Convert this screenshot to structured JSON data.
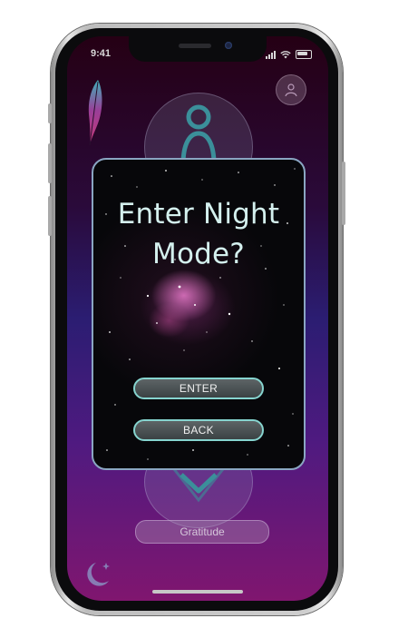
{
  "status_bar": {
    "time": "9:41",
    "icons": [
      "cellular-signal-icon",
      "wifi-icon",
      "battery-icon"
    ]
  },
  "background_screen": {
    "icons": [
      "feather-icon",
      "profile-circle-icon",
      "meditation-figure-icon",
      "heart-icon",
      "moon-star-icon"
    ],
    "gratitude_label": "Gratitude"
  },
  "modal": {
    "title_line1": "Enter Night",
    "title_line2": "Mode?",
    "enter_label": "ENTER",
    "back_label": "BACK"
  },
  "colors": {
    "accent_teal": "#86d4cf",
    "title_text": "#d4f0ee",
    "gradient_top": "#250014",
    "gradient_mid": "#2b1d72",
    "gradient_bottom": "#80166f"
  }
}
